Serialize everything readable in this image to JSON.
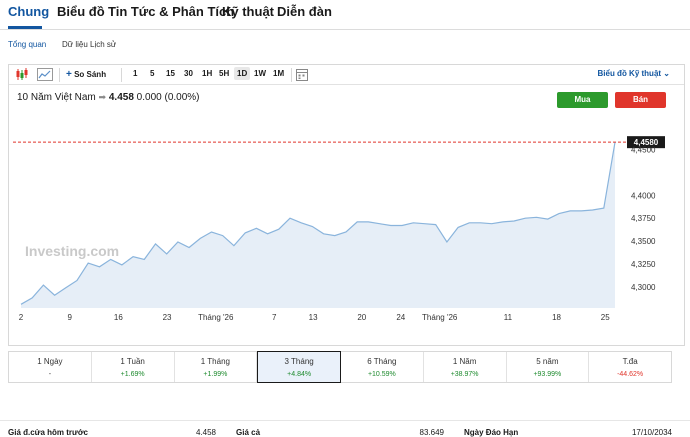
{
  "nav": {
    "tabs": [
      "Chung",
      "Biểu đồ",
      "Tin Tức & Phân Tích",
      "Kỹ thuật",
      "Diễn đàn"
    ],
    "sub_tabs": [
      "Tổng quan",
      "Dữ liệu Lịch sử"
    ]
  },
  "toolbar": {
    "compare_label": "So Sánh",
    "intervals": [
      "1",
      "5",
      "15",
      "30",
      "1H",
      "5H",
      "1D",
      "1W",
      "1M"
    ],
    "selected_interval": "1D",
    "advanced_chart_label": "Biểu đồ Kỹ thuật"
  },
  "instrument": {
    "name": "10 Năm Việt Nam",
    "price": "4.458",
    "change": "0.000",
    "change_pct": "(0.00%)"
  },
  "actions": {
    "buy_label": "Mua",
    "sell_label": "Bán"
  },
  "colors": {
    "accent": "#1256a0",
    "buy": "#2c9a2c",
    "sell": "#e0352b",
    "line": "#8ab4dc",
    "fill": "#e6eef7"
  },
  "chart_data": {
    "type": "area",
    "watermark": "Investing.com",
    "x_tick_labels": [
      "2",
      "9",
      "16",
      "23",
      "Tháng '26",
      "7",
      "13",
      "20",
      "24",
      "Tháng '26",
      "11",
      "18",
      "25"
    ],
    "y_tick_labels": [
      "4,4500",
      "4,4000",
      "4,3750",
      "4,3500",
      "4,3250",
      "4,3000"
    ],
    "ylim": [
      4.277,
      4.468
    ],
    "current_price_label": "4,4580",
    "current_price": 4.458,
    "values": [
      4.281,
      4.288,
      4.302,
      4.291,
      4.299,
      4.307,
      4.326,
      4.322,
      4.33,
      4.324,
      4.333,
      4.33,
      4.347,
      4.336,
      4.349,
      4.343,
      4.353,
      4.36,
      4.356,
      4.345,
      4.359,
      4.364,
      4.358,
      4.363,
      4.375,
      4.37,
      4.366,
      4.358,
      4.356,
      4.36,
      4.371,
      4.371,
      4.369,
      4.367,
      4.367,
      4.37,
      4.369,
      4.368,
      4.349,
      4.365,
      4.37,
      4.37,
      4.369,
      4.371,
      4.372,
      4.375,
      4.376,
      4.374,
      4.38,
      4.383,
      4.383,
      4.384,
      4.386,
      4.458
    ]
  },
  "periods": [
    {
      "label": "1 Ngày",
      "change": "-",
      "dir": "neu"
    },
    {
      "label": "1 Tuần",
      "change": "+1.69%",
      "dir": "pos"
    },
    {
      "label": "1 Tháng",
      "change": "+1.99%",
      "dir": "pos"
    },
    {
      "label": "3 Tháng",
      "change": "+4.84%",
      "dir": "pos"
    },
    {
      "label": "6 Tháng",
      "change": "+10.59%",
      "dir": "pos"
    },
    {
      "label": "1 Năm",
      "change": "+38.97%",
      "dir": "pos"
    },
    {
      "label": "5 năm",
      "change": "+93.99%",
      "dir": "pos"
    },
    {
      "label": "T.đa",
      "change": "-44.62%",
      "dir": "neg"
    }
  ],
  "active_period": "3 Tháng",
  "stats": [
    {
      "label": "Giá đ.cửa hôm trước",
      "value": "4.458"
    },
    {
      "label": "Giá cả",
      "value": "83.649"
    },
    {
      "label": "Ngày Đáo Hạn",
      "value": "17/10/2034"
    }
  ]
}
